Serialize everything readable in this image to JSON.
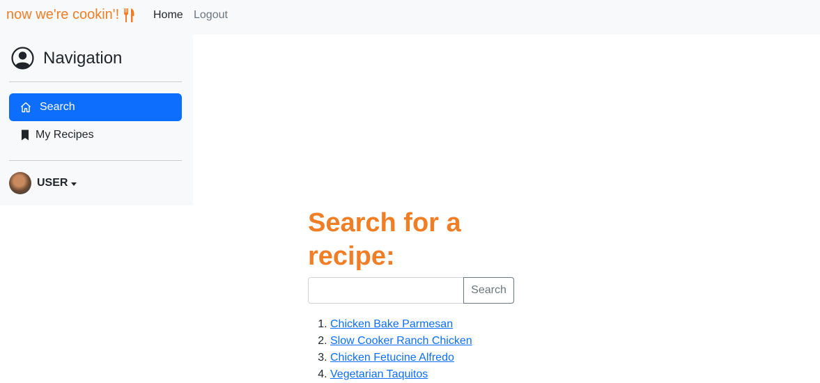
{
  "navbar": {
    "brand": "now we're cookin'!",
    "brand_icon": "fork-knife-icon",
    "links": [
      {
        "label": "Home"
      },
      {
        "label": "Logout"
      }
    ]
  },
  "sidebar": {
    "title": "Navigation",
    "title_icon": "person-circle-icon",
    "items": [
      {
        "label": "Search",
        "icon": "house-icon",
        "active": true
      },
      {
        "label": "My Recipes",
        "icon": "bookmark-icon",
        "active": false
      }
    ],
    "user": {
      "name": "USER",
      "icon": "chevron-down-icon"
    }
  },
  "main": {
    "heading": "Search for a recipe:",
    "search": {
      "value": "",
      "button_label": "Search"
    },
    "results": [
      "Chicken Bake Parmesan",
      "Slow Cooker Ranch Chicken",
      "Chicken Fetucine Alfredo",
      "Vegetarian Taquitos"
    ]
  },
  "colors": {
    "brand": "#f07e26",
    "accent": "#0d6efd",
    "sidebar_bg": "#f8f9fa"
  }
}
